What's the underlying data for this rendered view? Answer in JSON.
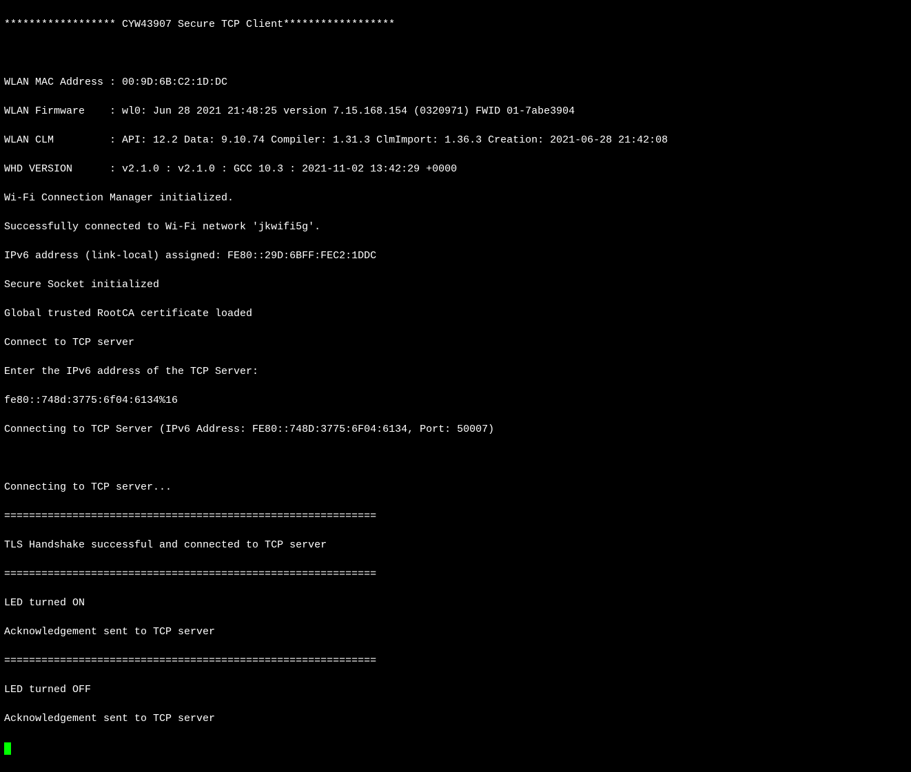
{
  "console": {
    "lines": [
      "****************** CYW43907 Secure TCP Client******************",
      "",
      "WLAN MAC Address : 00:9D:6B:C2:1D:DC",
      "WLAN Firmware    : wl0: Jun 28 2021 21:48:25 version 7.15.168.154 (0320971) FWID 01-7abe3904",
      "WLAN CLM         : API: 12.2 Data: 9.10.74 Compiler: 1.31.3 ClmImport: 1.36.3 Creation: 2021-06-28 21:42:08",
      "WHD VERSION      : v2.1.0 : v2.1.0 : GCC 10.3 : 2021-11-02 13:42:29 +0000",
      "Wi-Fi Connection Manager initialized.",
      "Successfully connected to Wi-Fi network 'jkwifi5g'.",
      "IPv6 address (link-local) assigned: FE80::29D:6BFF:FEC2:1DDC",
      "Secure Socket initialized",
      "Global trusted RootCA certificate loaded",
      "Connect to TCP server",
      "Enter the IPv6 address of the TCP Server:",
      "fe80::748d:3775:6f04:6134%16",
      "Connecting to TCP Server (IPv6 Address: FE80::748D:3775:6F04:6134, Port: 50007)",
      "",
      "Connecting to TCP server...",
      "============================================================",
      "TLS Handshake successful and connected to TCP server",
      "============================================================",
      "LED turned ON",
      "Acknowledgement sent to TCP server",
      "============================================================",
      "LED turned OFF",
      "Acknowledgement sent to TCP server"
    ]
  }
}
